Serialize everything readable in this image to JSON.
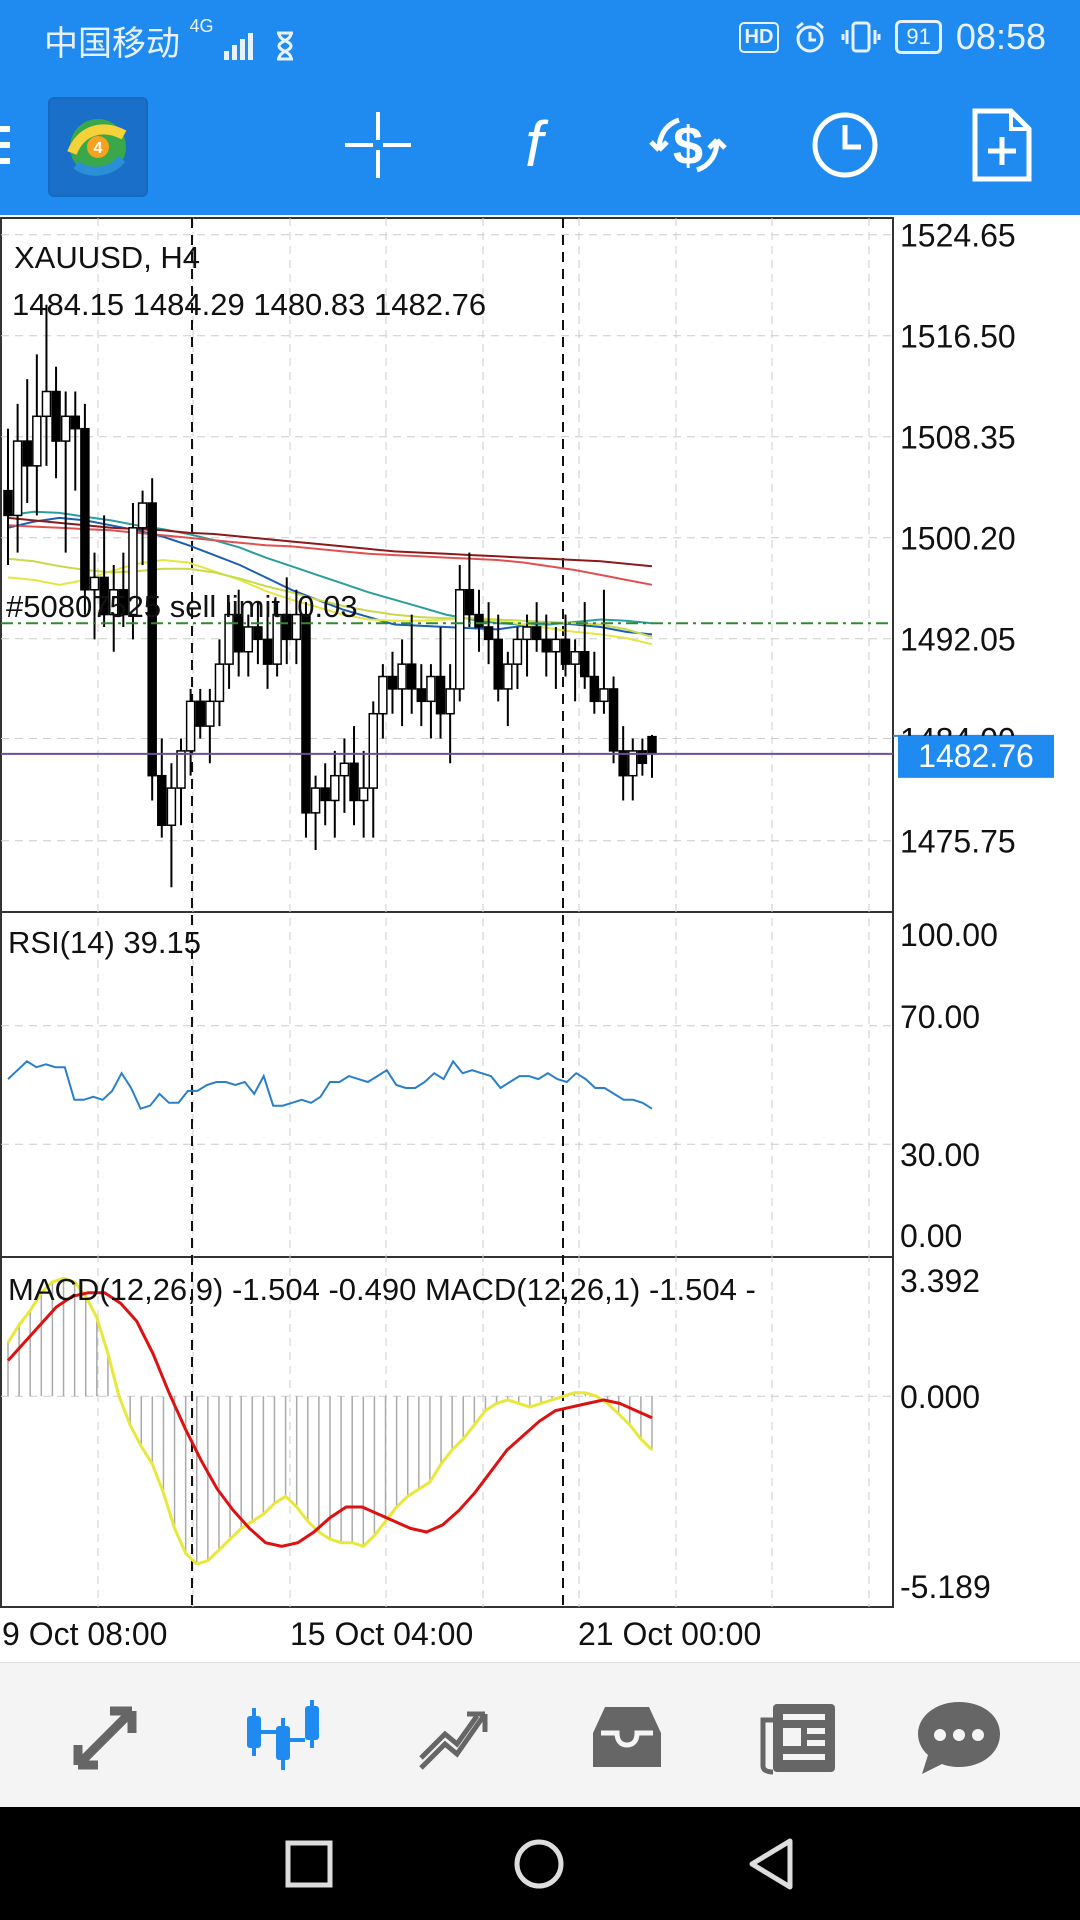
{
  "status_bar": {
    "carrier": "中国移动",
    "network": "4G",
    "hd_badge": "HD",
    "battery": "91",
    "time": "08:58"
  },
  "toolbar": {
    "icons": [
      "menu-icon",
      "mt4-logo-icon",
      "crosshair-icon",
      "indicators-icon",
      "trade-icon",
      "timeframe-clock-icon",
      "new-order-icon"
    ]
  },
  "main_chart": {
    "symbol": "XAUUSD, H4",
    "ohlc": "1484.15 1484.29 1480.83 1482.76",
    "order_label": "#50807525 sell limit, 0.03",
    "order_price": 1493.3,
    "current_price": "1482.76",
    "price_axis": [
      "1524.65",
      "1516.50",
      "1508.35",
      "1500.20",
      "1492.05",
      "1484.00",
      "1475.75"
    ],
    "price_range": [
      1470.0,
      1526.0
    ],
    "colors": {
      "current_price_tag": "#1f8bf0",
      "order_line": "#2e8b2e"
    }
  },
  "rsi_panel": {
    "label": "RSI(14) 39.15",
    "levels": [
      "100.00",
      "70.00",
      "30.00",
      "0.00"
    ],
    "color": "#2a7fc9"
  },
  "macd_panel": {
    "label": "MACD(12,26,9) -1.504 -0.490 MACD(12,26,1) -1.504 -",
    "levels": [
      "3.392",
      "0.000",
      "-5.189"
    ],
    "colors": {
      "signal": "#d11",
      "macd": "#e8e83a",
      "histogram": "#aaa"
    }
  },
  "time_axis": [
    "9 Oct 08:00",
    "15 Oct 04:00",
    "21 Oct 00:00"
  ],
  "bottom_nav": {
    "items": [
      "quotes-icon",
      "chart-icon",
      "trade-icon",
      "history-icon",
      "news-icon",
      "chat-icon"
    ],
    "active": "chart-icon",
    "active_color": "#1f8bf0"
  },
  "chart_data": [
    {
      "type": "candlestick",
      "title": "XAUUSD, H4",
      "ylim": [
        1470.0,
        1526.0
      ],
      "candles_ohlc": [
        [
          1504,
          1509,
          1498,
          1502
        ],
        [
          1502,
          1511,
          1499,
          1508
        ],
        [
          1508,
          1513,
          1503,
          1506
        ],
        [
          1506,
          1515,
          1502,
          1510
        ],
        [
          1510,
          1519,
          1506,
          1512
        ],
        [
          1512,
          1514,
          1505,
          1508
        ],
        [
          1508,
          1512,
          1499,
          1510
        ],
        [
          1510,
          1512,
          1504,
          1509
        ],
        [
          1509,
          1511,
          1494,
          1496
        ],
        [
          1496,
          1499,
          1492,
          1497
        ],
        [
          1497,
          1502,
          1493,
          1494
        ],
        [
          1494,
          1498,
          1491,
          1496
        ],
        [
          1496,
          1499,
          1493,
          1494
        ],
        [
          1494,
          1503,
          1492,
          1501
        ],
        [
          1501,
          1504,
          1498,
          1503
        ],
        [
          1503,
          1505,
          1479,
          1481
        ],
        [
          1481,
          1484,
          1476,
          1477
        ],
        [
          1477,
          1482,
          1472,
          1480
        ],
        [
          1480,
          1484,
          1477,
          1483
        ],
        [
          1483,
          1488,
          1481,
          1487
        ],
        [
          1487,
          1488,
          1484,
          1485
        ],
        [
          1485,
          1488,
          1482,
          1487
        ],
        [
          1487,
          1492,
          1485,
          1490
        ],
        [
          1490,
          1495,
          1488,
          1494
        ],
        [
          1494,
          1496,
          1489,
          1491
        ],
        [
          1491,
          1494,
          1489,
          1493
        ],
        [
          1493,
          1495,
          1490,
          1492
        ],
        [
          1492,
          1494,
          1488,
          1490
        ],
        [
          1490,
          1495,
          1489,
          1494
        ],
        [
          1494,
          1497,
          1490,
          1492
        ],
        [
          1492,
          1496,
          1490,
          1494
        ],
        [
          1494,
          1495,
          1476,
          1478
        ],
        [
          1478,
          1481,
          1475,
          1480
        ],
        [
          1480,
          1482,
          1477,
          1479
        ],
        [
          1479,
          1483,
          1476,
          1481
        ],
        [
          1481,
          1484,
          1478,
          1482
        ],
        [
          1482,
          1485,
          1477,
          1479
        ],
        [
          1479,
          1483,
          1476,
          1480
        ],
        [
          1480,
          1487,
          1476,
          1486
        ],
        [
          1486,
          1490,
          1484,
          1489
        ],
        [
          1489,
          1491,
          1486,
          1488
        ],
        [
          1488,
          1492,
          1485,
          1490
        ],
        [
          1490,
          1494,
          1486,
          1488
        ],
        [
          1488,
          1490,
          1485,
          1487
        ],
        [
          1487,
          1490,
          1484,
          1489
        ],
        [
          1489,
          1493,
          1484,
          1486
        ],
        [
          1486,
          1490,
          1482,
          1488
        ],
        [
          1488,
          1498,
          1487,
          1496
        ],
        [
          1496,
          1499,
          1493,
          1494
        ],
        [
          1494,
          1496,
          1491,
          1493
        ],
        [
          1493,
          1495,
          1490,
          1492
        ],
        [
          1492,
          1494,
          1487,
          1488
        ],
        [
          1488,
          1491,
          1485,
          1490
        ],
        [
          1490,
          1493,
          1488,
          1492
        ],
        [
          1492,
          1494,
          1489,
          1493
        ],
        [
          1493,
          1495,
          1491,
          1492
        ],
        [
          1492,
          1494,
          1489,
          1491
        ],
        [
          1491,
          1493,
          1488,
          1492
        ],
        [
          1492,
          1494,
          1489,
          1490
        ],
        [
          1490,
          1492,
          1487,
          1491
        ],
        [
          1491,
          1495,
          1488,
          1489
        ],
        [
          1489,
          1491,
          1486,
          1487
        ],
        [
          1487,
          1496,
          1486,
          1488
        ],
        [
          1488,
          1489,
          1482,
          1483
        ],
        [
          1483,
          1485,
          1479,
          1481
        ],
        [
          1481,
          1484,
          1479,
          1483
        ],
        [
          1483,
          1484,
          1481,
          1482
        ],
        [
          1484.15,
          1484.29,
          1480.83,
          1482.76
        ]
      ],
      "moving_averages": [
        {
          "color": "#1a5fb4",
          "values": [
            1501,
            1501.5,
            1501.8,
            1501.6,
            1501.2,
            1500.8,
            1500.3,
            1499.6,
            1498.8,
            1498,
            1497,
            1496,
            1495.2,
            1494.4,
            1493.8,
            1493.2,
            1493.1,
            1493.0,
            1492.9,
            1492.8,
            1493.1,
            1493.4,
            1493.2,
            1493.0,
            1492.6,
            1492.4
          ]
        },
        {
          "color": "#2a9d9d",
          "values": [
            1502,
            1502.3,
            1502.2,
            1501.9,
            1501.6,
            1501.2,
            1500.9,
            1500.5,
            1500.0,
            1499.4,
            1498.6,
            1497.9,
            1497.2,
            1496.5,
            1495.8,
            1495.2,
            1494.6,
            1494.0,
            1493.6,
            1493.3,
            1493.2,
            1493.2,
            1493.4,
            1493.6,
            1493.5,
            1493.3
          ]
        },
        {
          "color": "#e6e640",
          "values": [
            1497,
            1496.8,
            1496.4,
            1496.8,
            1497.5,
            1498.1,
            1498.4,
            1498.2,
            1497.5,
            1496.8,
            1495.9,
            1495.2,
            1494.6,
            1494.0,
            1493.6,
            1493.5,
            1493.5,
            1493.6,
            1493.7,
            1493.5,
            1493.2,
            1492.9,
            1492.6,
            1492.4,
            1492.1,
            1491.6
          ]
        },
        {
          "color": "#c9d94a",
          "values": [
            1498.5,
            1498.3,
            1497.9,
            1497.6,
            1497.4,
            1497.5,
            1497.7,
            1497.7,
            1497.4,
            1496.9,
            1496.3,
            1495.8,
            1495.2,
            1494.7,
            1494.3,
            1494.0,
            1493.8,
            1493.7,
            1493.7,
            1493.6,
            1493.5,
            1493.4,
            1493.3,
            1493.2,
            1492.8,
            1492.2
          ]
        },
        {
          "color": "#8b1a1a",
          "values": [
            1501.8,
            1501.6,
            1501.4,
            1501.2,
            1501.0,
            1500.9,
            1500.8,
            1500.6,
            1500.5,
            1500.3,
            1500.1,
            1499.9,
            1499.7,
            1499.5,
            1499.3,
            1499.1,
            1499.0,
            1498.9,
            1498.8,
            1498.7,
            1498.6,
            1498.5,
            1498.4,
            1498.3,
            1498.1,
            1497.9
          ]
        },
        {
          "color": "#e05050",
          "values": [
            1501.2,
            1501.1,
            1501.0,
            1500.9,
            1500.8,
            1500.6,
            1500.4,
            1500.2,
            1500.0,
            1499.8,
            1499.6,
            1499.5,
            1499.3,
            1499.1,
            1498.9,
            1498.8,
            1498.7,
            1498.6,
            1498.5,
            1498.4,
            1498.2,
            1497.9,
            1497.6,
            1497.2,
            1496.8,
            1496.4
          ]
        }
      ]
    },
    {
      "type": "line",
      "title": "RSI(14) 39.15",
      "ylim": [
        0,
        100
      ],
      "values": [
        52,
        55,
        58,
        56,
        57,
        56,
        56,
        45,
        45,
        46,
        45,
        48,
        54,
        49,
        42,
        43,
        47,
        44,
        44,
        48,
        48,
        50,
        51,
        51,
        50,
        51,
        47,
        53,
        43,
        43,
        44,
        45,
        44,
        46,
        51,
        51,
        53,
        52,
        51,
        53,
        55,
        50,
        49,
        49,
        51,
        54,
        52,
        58,
        54,
        55,
        54,
        53,
        49,
        51,
        53,
        53,
        52,
        54,
        52,
        51,
        54,
        52,
        49,
        49,
        47,
        45,
        45,
        44,
        42
      ],
      "color": "#2a7fc9"
    },
    {
      "type": "bar+line",
      "title": "MACD(12,26,9) -1.504 -0.490 MACD(12,26,1) -1.504 -",
      "ylim": [
        -5.9,
        3.9
      ],
      "histogram": [
        1.5,
        2.0,
        2.4,
        2.9,
        3.2,
        3.3,
        3.2,
        2.8,
        2.2,
        1.2,
        0.0,
        -0.8,
        -1.4,
        -1.9,
        -2.7,
        -3.7,
        -4.4,
        -4.7,
        -4.6,
        -4.3,
        -4.0,
        -3.7,
        -3.5,
        -3.3,
        -3.0,
        -2.8,
        -3.1,
        -3.5,
        -3.8,
        -4.0,
        -4.1,
        -4.1,
        -4.2,
        -3.9,
        -3.5,
        -3.1,
        -2.8,
        -2.6,
        -2.4,
        -1.9,
        -1.5,
        -1.2,
        -0.8,
        -0.4,
        -0.2,
        -0.1,
        -0.2,
        -0.3,
        -0.2,
        -0.1,
        0.0,
        0.1,
        0.1,
        0.0,
        -0.2,
        -0.5,
        -0.8,
        -1.2,
        -1.5
      ],
      "signal": [
        1.0,
        1.5,
        2.0,
        2.5,
        2.8,
        2.9,
        2.9,
        2.6,
        2.1,
        1.2,
        0.1,
        -0.9,
        -1.8,
        -2.6,
        -3.2,
        -3.7,
        -4.1,
        -4.2,
        -4.1,
        -3.8,
        -3.4,
        -3.1,
        -3.1,
        -3.3,
        -3.5,
        -3.7,
        -3.8,
        -3.6,
        -3.2,
        -2.7,
        -2.1,
        -1.5,
        -1.1,
        -0.7,
        -0.4,
        -0.3,
        -0.2,
        -0.1,
        -0.2,
        -0.4,
        -0.6
      ],
      "colors": {
        "signal": "#d11",
        "macd": "#e8e83a",
        "histogram": "#aaa"
      }
    }
  ]
}
